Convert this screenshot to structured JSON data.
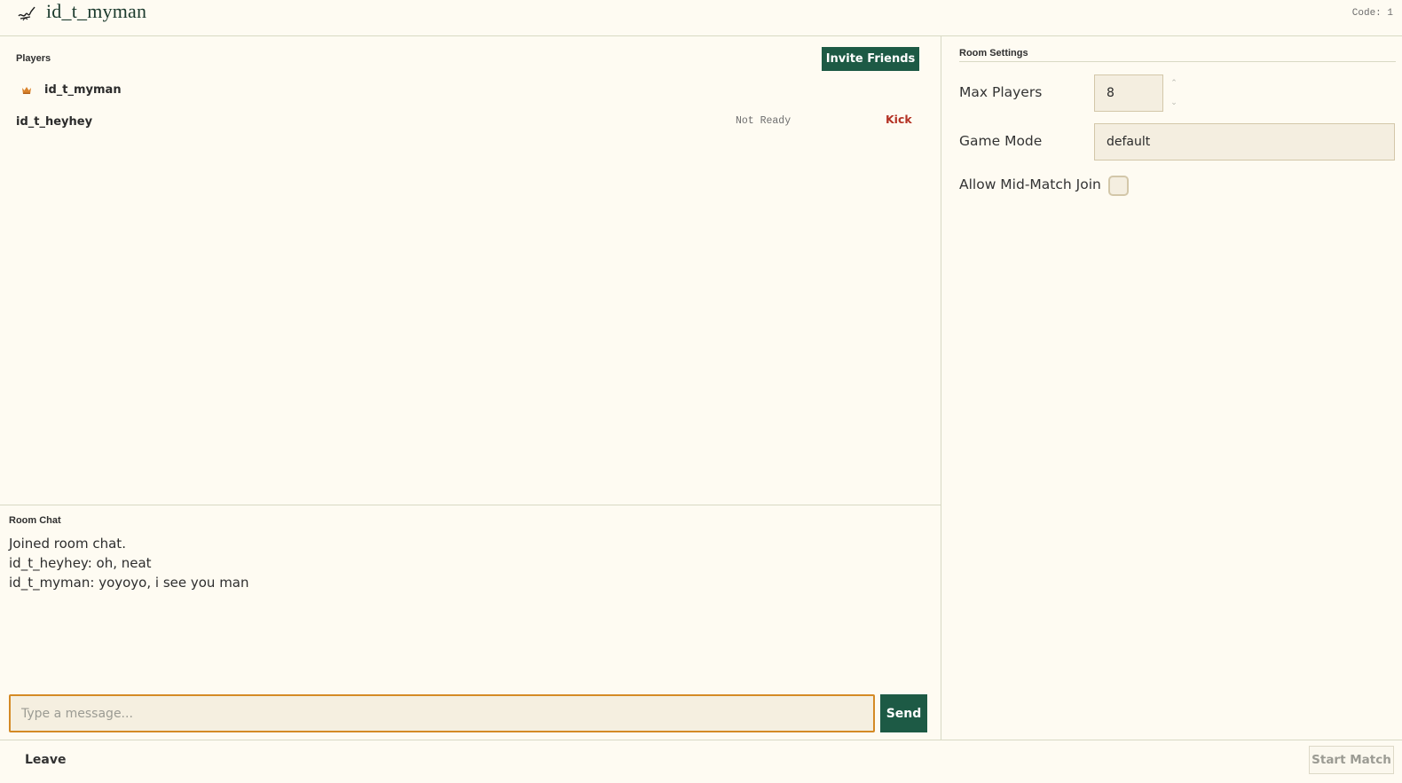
{
  "header": {
    "title": "id_t_myman",
    "code": "Code: 1",
    "logo_icon": "signature-logo-icon"
  },
  "players": {
    "section_label": "Players",
    "invite_label": "Invite Friends",
    "list": [
      {
        "name": "id_t_myman",
        "is_host": true,
        "icon": "crown-icon"
      },
      {
        "name": "id_t_heyhey",
        "status": "Not Ready",
        "action": "Kick"
      }
    ]
  },
  "chat": {
    "section_label": "Room Chat",
    "messages": [
      "Joined room chat.",
      "id_t_heyhey: oh, neat",
      "id_t_myman: yoyoyo, i see you man"
    ],
    "input_placeholder": "Type a message...",
    "input_value": "",
    "send_label": "Send"
  },
  "settings": {
    "title": "Room Settings",
    "max_players_label": "Max Players",
    "max_players_value": "8",
    "game_mode_label": "Game Mode",
    "game_mode_value": "default",
    "allow_mid_match_label": "Allow Mid-Match Join",
    "allow_mid_match_checked": false
  },
  "footer": {
    "leave_label": "Leave",
    "start_label": "Start Match"
  },
  "colors": {
    "background": "#fefbf2",
    "primary_button": "#1d5a45",
    "kick": "#b43224",
    "input_focus_border": "#d48a25",
    "crown": "#d9822b"
  }
}
